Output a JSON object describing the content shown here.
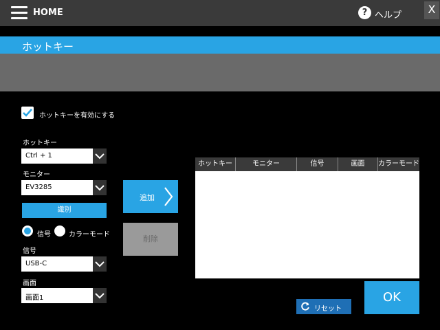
{
  "header": {
    "home": "HOME",
    "help": "ヘルプ",
    "close": "X"
  },
  "title": "ホットキー",
  "enable": {
    "label": "ホットキーを有効にする",
    "checked": true
  },
  "hotkey": {
    "label": "ホットキー",
    "value": "Ctrl + 1"
  },
  "monitor": {
    "label": "モニター",
    "value": "EV3285"
  },
  "identify": "識別",
  "mode": {
    "signal": "信号",
    "color_mode": "カラーモード",
    "selected": "signal"
  },
  "signal": {
    "label": "信号",
    "value": "USB-C"
  },
  "screen": {
    "label": "画面",
    "value": "画面1"
  },
  "buttons": {
    "add": "追加",
    "delete": "削除",
    "reset": "リセット",
    "ok": "OK"
  },
  "table": {
    "columns": [
      "ホットキー",
      "モニター",
      "信号",
      "画面",
      "カラーモード"
    ],
    "rows": []
  },
  "colors": {
    "accent": "#29a4e4",
    "bar": "#3a3a3a",
    "band": "#6a6a6a",
    "disabled": "#9a9a9a",
    "reset": "#1f6fb5"
  }
}
